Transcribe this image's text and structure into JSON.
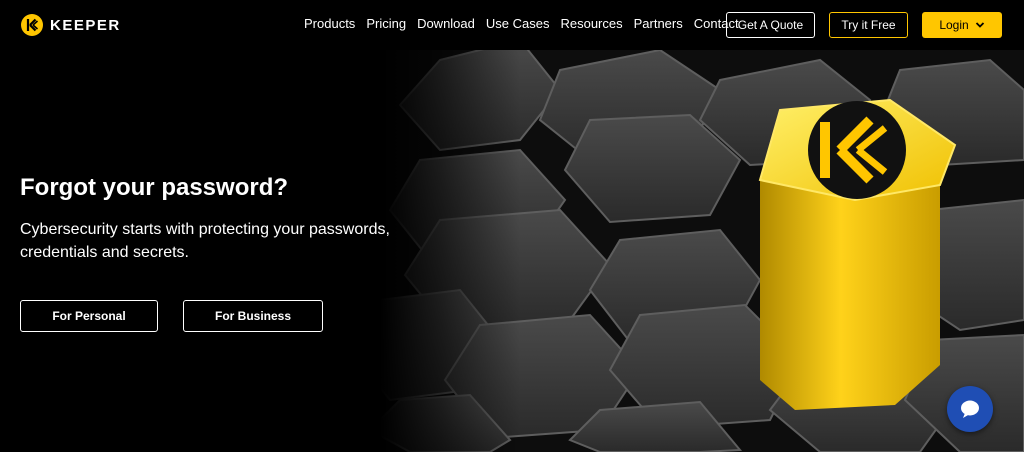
{
  "brand": {
    "name": "KEEPER"
  },
  "nav": {
    "items": [
      "Products",
      "Pricing",
      "Download",
      "Use Cases",
      "Resources",
      "Partners",
      "Contact"
    ],
    "quote_label": "Get A Quote",
    "try_label": "Try it Free",
    "login_label": "Login"
  },
  "hero": {
    "title": "Forgot your password?",
    "subtitle": "Cybersecurity starts with protecting your passwords, credentials and secrets.",
    "personal_label": "For Personal",
    "business_label": "For Business"
  },
  "icons": {
    "logo": "keeper-logo-icon",
    "login_chevron": "chevron-down-icon",
    "chat": "chat-bubble-icon"
  },
  "colors": {
    "accent": "#ffc600",
    "background": "#000000",
    "chat": "#1f4eb4"
  }
}
